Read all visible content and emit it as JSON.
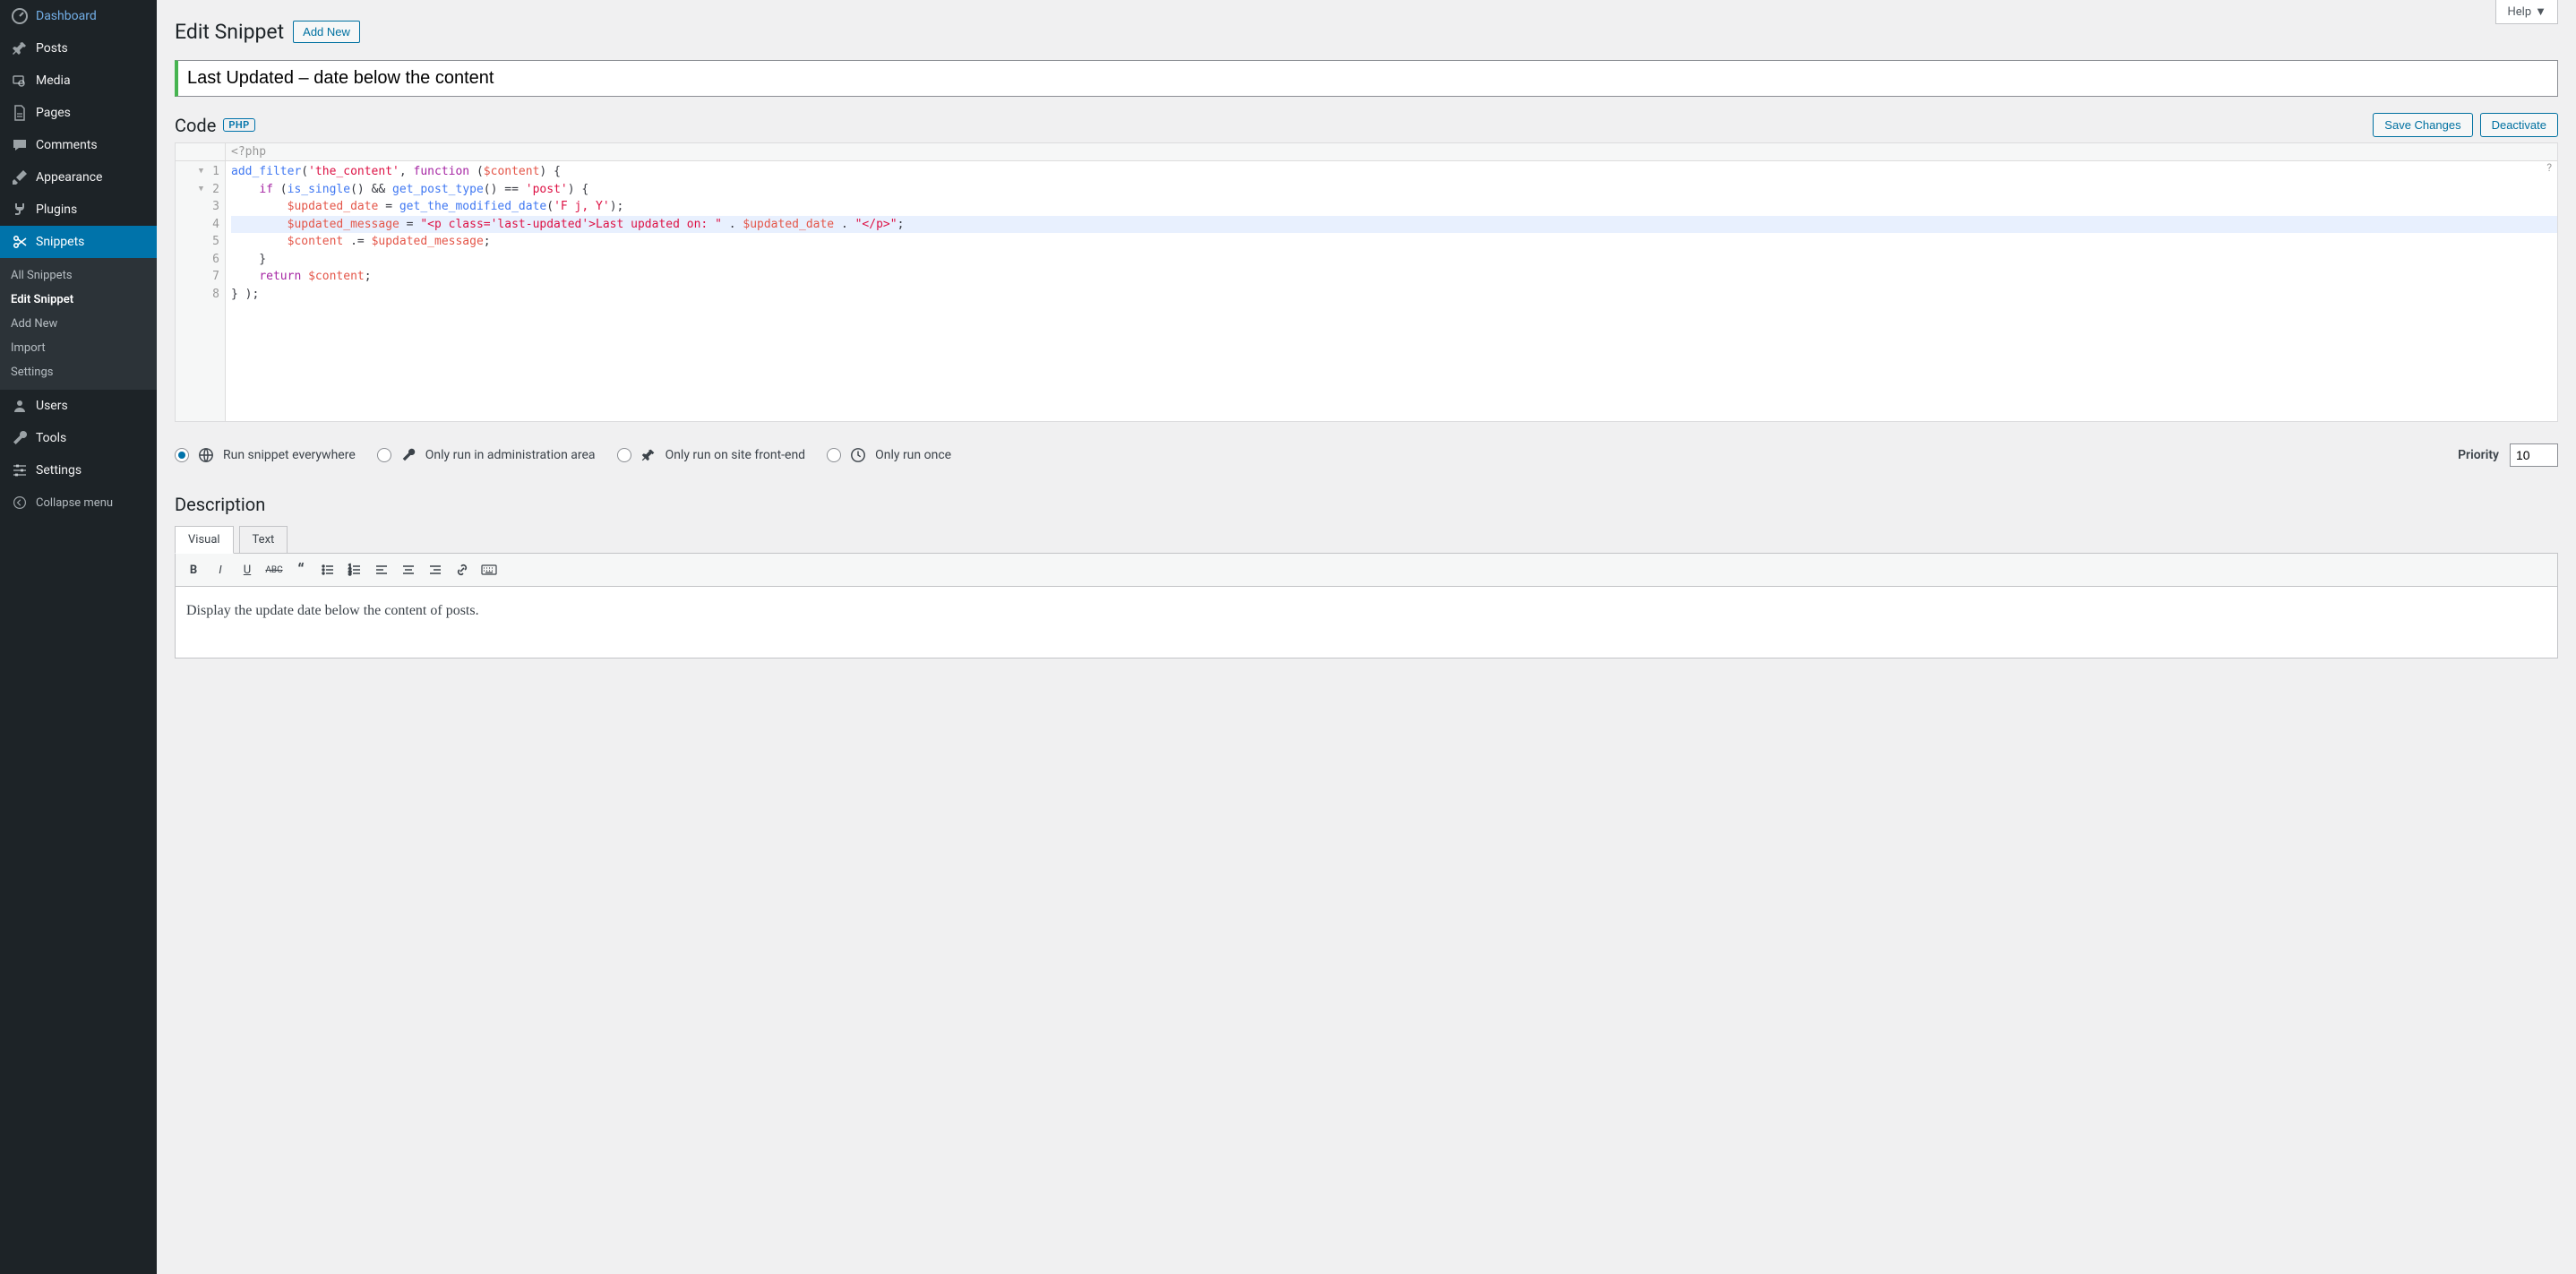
{
  "help_label": "Help",
  "page_title": "Edit Snippet",
  "add_new_label": "Add New",
  "sidebar": {
    "items": [
      {
        "label": "Dashboard"
      },
      {
        "label": "Posts"
      },
      {
        "label": "Media"
      },
      {
        "label": "Pages"
      },
      {
        "label": "Comments"
      },
      {
        "label": "Appearance"
      },
      {
        "label": "Plugins"
      },
      {
        "label": "Snippets"
      },
      {
        "label": "Users"
      },
      {
        "label": "Tools"
      },
      {
        "label": "Settings"
      }
    ],
    "submenu": [
      {
        "label": "All Snippets"
      },
      {
        "label": "Edit Snippet"
      },
      {
        "label": "Add New"
      },
      {
        "label": "Import"
      },
      {
        "label": "Settings"
      }
    ],
    "collapse_label": "Collapse menu"
  },
  "snippet_title": "Last Updated – date below the content",
  "code_section_label": "Code",
  "php_badge": "PHP",
  "save_label": "Save Changes",
  "deactivate_label": "Deactivate",
  "code_prefix": "<?php",
  "scope": {
    "options": [
      {
        "label": "Run snippet everywhere"
      },
      {
        "label": "Only run in administration area"
      },
      {
        "label": "Only run on site front-end"
      },
      {
        "label": "Only run once"
      }
    ],
    "selected": 0
  },
  "priority_label": "Priority",
  "priority_value": "10",
  "description_heading": "Description",
  "editor_tabs": {
    "visual": "Visual",
    "text": "Text"
  },
  "description_body": "Display the update date below the content of posts."
}
